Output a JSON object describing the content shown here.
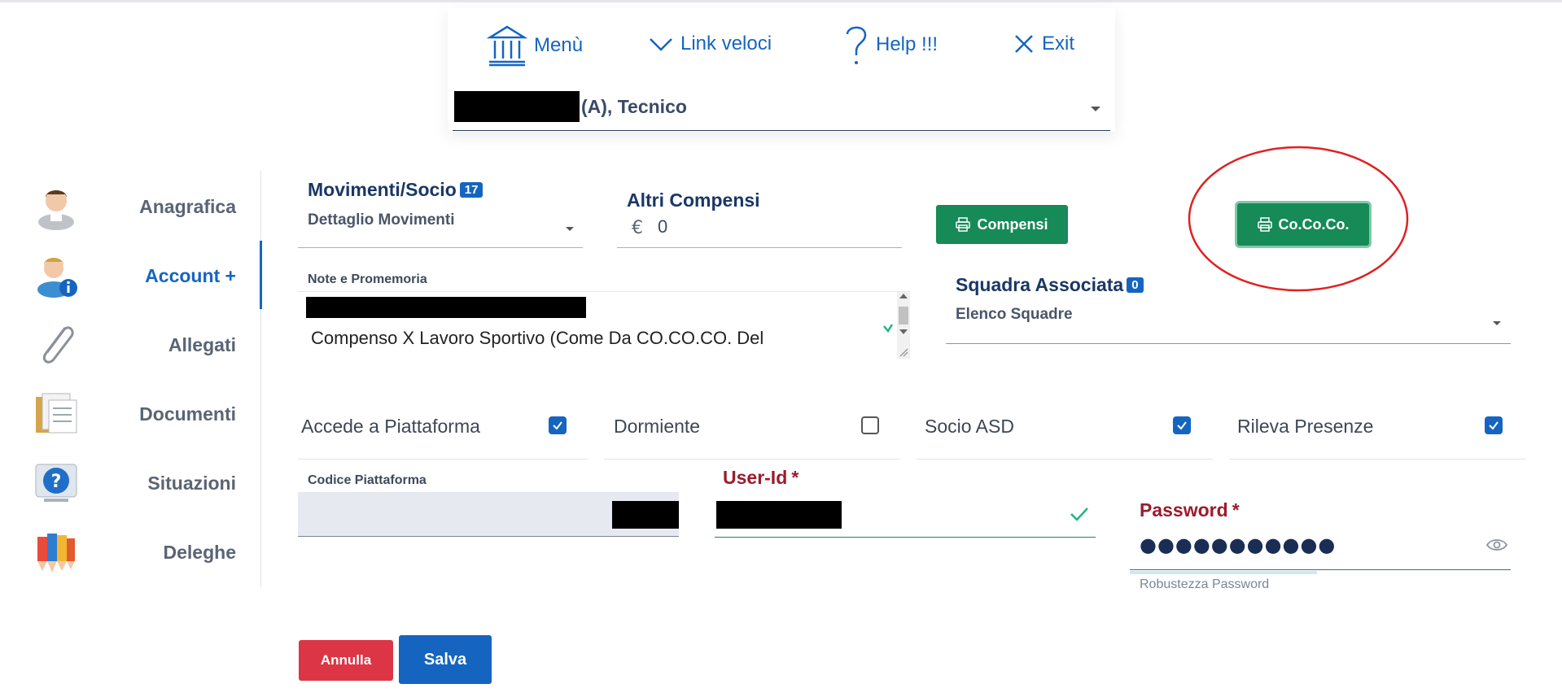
{
  "nav": {
    "menu_label": "Menù",
    "quicklinks_label": "Link veloci",
    "help_label": "Help !!!",
    "exit_label": "Exit"
  },
  "role": {
    "text": "(A), Tecnico"
  },
  "sidebar": {
    "items": [
      {
        "label": "Anagrafica",
        "icon": "user-icon"
      },
      {
        "label": "Account +",
        "icon": "user-info-icon",
        "active": true
      },
      {
        "label": "Allegati",
        "icon": "paperclip-icon"
      },
      {
        "label": "Documenti",
        "icon": "documents-icon"
      },
      {
        "label": "Situazioni",
        "icon": "question-icon"
      },
      {
        "label": "Deleghe",
        "icon": "pencils-icon"
      }
    ]
  },
  "movimenti": {
    "title": "Movimenti/Socio",
    "badge": "17",
    "select_value": "Dettaglio Movimenti"
  },
  "compensi": {
    "title": "Altri Compensi",
    "currency": "€",
    "value": "0"
  },
  "buttons": {
    "compensi": "Compensi",
    "cococo": "Co.Co.Co.",
    "annulla": "Annulla",
    "salva": "Salva"
  },
  "note": {
    "label": "Note e Promemoria",
    "text": "Compenso X Lavoro Sportivo (Come Da CO.CO.CO. Del"
  },
  "squadra": {
    "title": "Squadra Associata",
    "badge": "0",
    "select_value": "Elenco Squadre"
  },
  "checks": [
    {
      "label": "Accede a Piattaforma",
      "checked": true
    },
    {
      "label": "Dormiente",
      "checked": false
    },
    {
      "label": "Socio ASD",
      "checked": true
    },
    {
      "label": "Rileva Presenze",
      "checked": true
    }
  ],
  "codice": {
    "label": "Codice Piattaforma"
  },
  "userid": {
    "label": "User-Id",
    "required_mark": "*"
  },
  "password": {
    "label": "Password",
    "required_mark": "*",
    "value": "●●●●●●●●●●●",
    "strength_label": "Robustezza Password"
  },
  "colors": {
    "primary": "#1565c0",
    "green": "#168a57",
    "danger": "#dc3545",
    "annotation": "#e02020"
  }
}
